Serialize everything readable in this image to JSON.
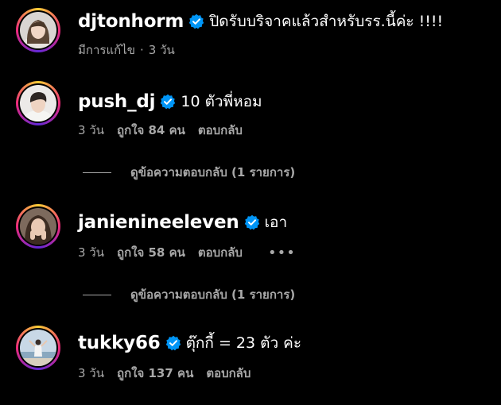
{
  "comments": [
    {
      "username": "djtonhorm",
      "text": "ปิดรับบริจาคแล้วสำหรับรร.นี้ค่ะ !!!!",
      "meta_edited": "มีการแก้ไข",
      "meta_sep": "·",
      "time": "3 วัน"
    },
    {
      "username": "push_dj",
      "text": "10 ตัวพี่หอม",
      "time": "3 วัน",
      "likes": "ถูกใจ 84 คน",
      "reply": "ตอบกลับ",
      "view_replies": "ดูข้อความตอบกลับ (1 รายการ)"
    },
    {
      "username": "janienineeleven",
      "text": "เอา",
      "time": "3 วัน",
      "likes": "ถูกใจ 58 คน",
      "reply": "ตอบกลับ",
      "more": "•••",
      "view_replies": "ดูข้อความตอบกลับ (1 รายการ)"
    },
    {
      "username": "tukky66",
      "text": "ตุ๊กกี้ = 23 ตัว ค่ะ",
      "time": "3 วัน",
      "likes": "ถูกใจ 137 คน",
      "reply": "ตอบกลับ"
    }
  ],
  "colors": {
    "background": "#000000",
    "verified": "#0095f6",
    "muted": "#a8a8a8"
  }
}
